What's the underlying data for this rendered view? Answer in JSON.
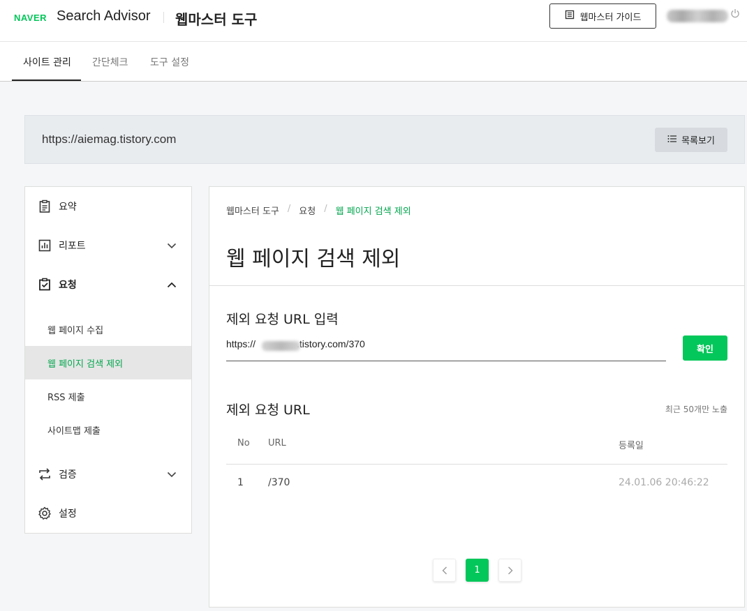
{
  "header": {
    "brand": "NAVER",
    "app_name": "Search Advisor",
    "tool_name": "웹마스터 도구",
    "guide_label": "웹마스터 가이드"
  },
  "tabs": [
    {
      "label": "사이트 관리",
      "active": true
    },
    {
      "label": "간단체크",
      "active": false
    },
    {
      "label": "도구 설정",
      "active": false
    }
  ],
  "site": {
    "url": "https://aiemag.tistory.com",
    "list_label": "목록보기"
  },
  "sidebar": {
    "items": [
      {
        "label": "요약",
        "icon": "clipboard-icon"
      },
      {
        "label": "리포트",
        "icon": "chart-icon",
        "chevron": "down"
      },
      {
        "label": "요청",
        "icon": "checklist-icon",
        "chevron": "up",
        "expanded": true
      },
      {
        "label": "검증",
        "icon": "swap-icon",
        "chevron": "down"
      },
      {
        "label": "설정",
        "icon": "gear-icon"
      }
    ],
    "subitems": [
      {
        "label": "웹 페이지 수집",
        "active": false
      },
      {
        "label": "웹 페이지 검색 제외",
        "active": true
      },
      {
        "label": "RSS 제출",
        "active": false
      },
      {
        "label": "사이트맵 제출",
        "active": false
      }
    ]
  },
  "breadcrumb": [
    "웹마스터 도구",
    "요청",
    "웹 페이지 검색 제외"
  ],
  "page_title": "웹 페이지 검색 제외",
  "form": {
    "section_title": "제외 요청 URL 입력",
    "input_value_prefix": "https://",
    "input_value_suffix": ".tistory.com/370",
    "confirm_label": "확인"
  },
  "list": {
    "section_title": "제외 요청 URL",
    "note": "최근 50개만 노출",
    "columns": [
      "No",
      "URL",
      "등록일"
    ],
    "rows": [
      {
        "no": "1",
        "url": "/370",
        "date": "24.01.06 20:46:22"
      }
    ]
  },
  "pagination": {
    "current": "1"
  },
  "colors": {
    "accent": "#03c75a",
    "accent_text": "#03a64e"
  }
}
